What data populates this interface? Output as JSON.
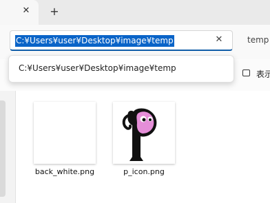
{
  "tabs": {
    "close_icon": "close-icon",
    "new_tab_icon": "plus-icon"
  },
  "address": {
    "value": "C:¥Users¥user¥Desktop¥image¥temp",
    "suggestion": "C:¥Users¥user¥Desktop¥image¥temp",
    "clear_icon": "close-icon",
    "right_crumb": "temp"
  },
  "toolbar": {
    "view_label": "表示"
  },
  "files": [
    {
      "name": "back_white.png",
      "thumbnail": "blank-white"
    },
    {
      "name": "p_icon.png",
      "thumbnail": "p-character-icon"
    }
  ],
  "colors": {
    "selection": "#0a64c8",
    "accent_underline": "#0f5ca8",
    "p_icon_pink": "#e58ed8"
  }
}
